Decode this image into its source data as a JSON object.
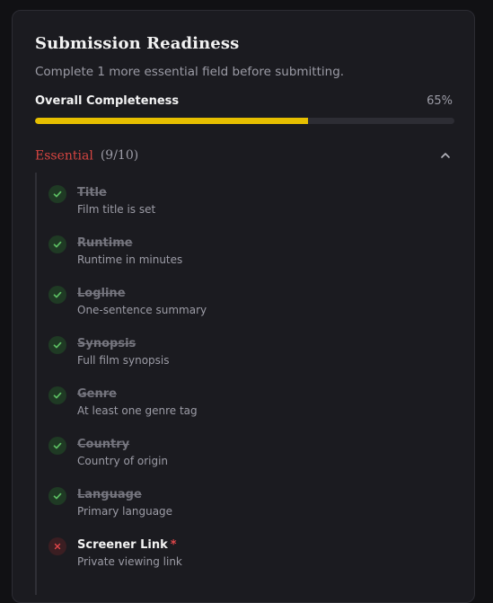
{
  "panel": {
    "title": "Submission Readiness",
    "subtitle": "Complete 1 more essential field before submitting.",
    "progress": {
      "label": "Overall Completeness",
      "value_text": "65%",
      "value": 0.65
    }
  },
  "section": {
    "name": "Essential",
    "count": "(9/10)",
    "expanded": true,
    "items": [
      {
        "label": "Title",
        "description": "Film title is set",
        "status": "done"
      },
      {
        "label": "Runtime",
        "description": "Runtime in minutes",
        "status": "done"
      },
      {
        "label": "Logline",
        "description": "One-sentence summary",
        "status": "done"
      },
      {
        "label": "Synopsis",
        "description": "Full film synopsis",
        "status": "done"
      },
      {
        "label": "Genre",
        "description": "At least one genre tag",
        "status": "done"
      },
      {
        "label": "Country",
        "description": "Country of origin",
        "status": "done"
      },
      {
        "label": "Language",
        "description": "Primary language",
        "status": "done"
      },
      {
        "label": "Screener Link",
        "description": "Private viewing link",
        "status": "missing",
        "required_mark": "*"
      }
    ]
  },
  "colors": {
    "accent": "#e6bf00",
    "essential": "#d64541",
    "done": "#4caf50",
    "missing": "#e0464a"
  },
  "icons": {
    "done": "check-circle-icon",
    "missing": "x-circle-icon",
    "collapse": "chevron-up-icon"
  }
}
